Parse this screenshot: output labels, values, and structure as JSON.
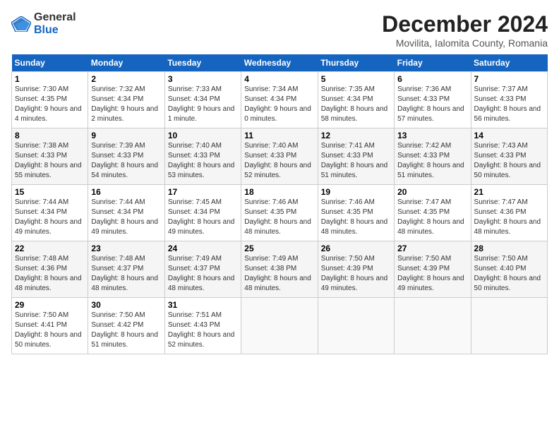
{
  "header": {
    "logo_general": "General",
    "logo_blue": "Blue",
    "month_title": "December 2024",
    "location": "Movilita, Ialomita County, Romania"
  },
  "weekdays": [
    "Sunday",
    "Monday",
    "Tuesday",
    "Wednesday",
    "Thursday",
    "Friday",
    "Saturday"
  ],
  "weeks": [
    [
      {
        "day": "1",
        "sunrise": "Sunrise: 7:30 AM",
        "sunset": "Sunset: 4:35 PM",
        "daylight": "Daylight: 9 hours and 4 minutes."
      },
      {
        "day": "2",
        "sunrise": "Sunrise: 7:32 AM",
        "sunset": "Sunset: 4:34 PM",
        "daylight": "Daylight: 9 hours and 2 minutes."
      },
      {
        "day": "3",
        "sunrise": "Sunrise: 7:33 AM",
        "sunset": "Sunset: 4:34 PM",
        "daylight": "Daylight: 9 hours and 1 minute."
      },
      {
        "day": "4",
        "sunrise": "Sunrise: 7:34 AM",
        "sunset": "Sunset: 4:34 PM",
        "daylight": "Daylight: 9 hours and 0 minutes."
      },
      {
        "day": "5",
        "sunrise": "Sunrise: 7:35 AM",
        "sunset": "Sunset: 4:34 PM",
        "daylight": "Daylight: 8 hours and 58 minutes."
      },
      {
        "day": "6",
        "sunrise": "Sunrise: 7:36 AM",
        "sunset": "Sunset: 4:33 PM",
        "daylight": "Daylight: 8 hours and 57 minutes."
      },
      {
        "day": "7",
        "sunrise": "Sunrise: 7:37 AM",
        "sunset": "Sunset: 4:33 PM",
        "daylight": "Daylight: 8 hours and 56 minutes."
      }
    ],
    [
      {
        "day": "8",
        "sunrise": "Sunrise: 7:38 AM",
        "sunset": "Sunset: 4:33 PM",
        "daylight": "Daylight: 8 hours and 55 minutes."
      },
      {
        "day": "9",
        "sunrise": "Sunrise: 7:39 AM",
        "sunset": "Sunset: 4:33 PM",
        "daylight": "Daylight: 8 hours and 54 minutes."
      },
      {
        "day": "10",
        "sunrise": "Sunrise: 7:40 AM",
        "sunset": "Sunset: 4:33 PM",
        "daylight": "Daylight: 8 hours and 53 minutes."
      },
      {
        "day": "11",
        "sunrise": "Sunrise: 7:40 AM",
        "sunset": "Sunset: 4:33 PM",
        "daylight": "Daylight: 8 hours and 52 minutes."
      },
      {
        "day": "12",
        "sunrise": "Sunrise: 7:41 AM",
        "sunset": "Sunset: 4:33 PM",
        "daylight": "Daylight: 8 hours and 51 minutes."
      },
      {
        "day": "13",
        "sunrise": "Sunrise: 7:42 AM",
        "sunset": "Sunset: 4:33 PM",
        "daylight": "Daylight: 8 hours and 51 minutes."
      },
      {
        "day": "14",
        "sunrise": "Sunrise: 7:43 AM",
        "sunset": "Sunset: 4:33 PM",
        "daylight": "Daylight: 8 hours and 50 minutes."
      }
    ],
    [
      {
        "day": "15",
        "sunrise": "Sunrise: 7:44 AM",
        "sunset": "Sunset: 4:34 PM",
        "daylight": "Daylight: 8 hours and 49 minutes."
      },
      {
        "day": "16",
        "sunrise": "Sunrise: 7:44 AM",
        "sunset": "Sunset: 4:34 PM",
        "daylight": "Daylight: 8 hours and 49 minutes."
      },
      {
        "day": "17",
        "sunrise": "Sunrise: 7:45 AM",
        "sunset": "Sunset: 4:34 PM",
        "daylight": "Daylight: 8 hours and 49 minutes."
      },
      {
        "day": "18",
        "sunrise": "Sunrise: 7:46 AM",
        "sunset": "Sunset: 4:35 PM",
        "daylight": "Daylight: 8 hours and 48 minutes."
      },
      {
        "day": "19",
        "sunrise": "Sunrise: 7:46 AM",
        "sunset": "Sunset: 4:35 PM",
        "daylight": "Daylight: 8 hours and 48 minutes."
      },
      {
        "day": "20",
        "sunrise": "Sunrise: 7:47 AM",
        "sunset": "Sunset: 4:35 PM",
        "daylight": "Daylight: 8 hours and 48 minutes."
      },
      {
        "day": "21",
        "sunrise": "Sunrise: 7:47 AM",
        "sunset": "Sunset: 4:36 PM",
        "daylight": "Daylight: 8 hours and 48 minutes."
      }
    ],
    [
      {
        "day": "22",
        "sunrise": "Sunrise: 7:48 AM",
        "sunset": "Sunset: 4:36 PM",
        "daylight": "Daylight: 8 hours and 48 minutes."
      },
      {
        "day": "23",
        "sunrise": "Sunrise: 7:48 AM",
        "sunset": "Sunset: 4:37 PM",
        "daylight": "Daylight: 8 hours and 48 minutes."
      },
      {
        "day": "24",
        "sunrise": "Sunrise: 7:49 AM",
        "sunset": "Sunset: 4:37 PM",
        "daylight": "Daylight: 8 hours and 48 minutes."
      },
      {
        "day": "25",
        "sunrise": "Sunrise: 7:49 AM",
        "sunset": "Sunset: 4:38 PM",
        "daylight": "Daylight: 8 hours and 48 minutes."
      },
      {
        "day": "26",
        "sunrise": "Sunrise: 7:50 AM",
        "sunset": "Sunset: 4:39 PM",
        "daylight": "Daylight: 8 hours and 49 minutes."
      },
      {
        "day": "27",
        "sunrise": "Sunrise: 7:50 AM",
        "sunset": "Sunset: 4:39 PM",
        "daylight": "Daylight: 8 hours and 49 minutes."
      },
      {
        "day": "28",
        "sunrise": "Sunrise: 7:50 AM",
        "sunset": "Sunset: 4:40 PM",
        "daylight": "Daylight: 8 hours and 50 minutes."
      }
    ],
    [
      {
        "day": "29",
        "sunrise": "Sunrise: 7:50 AM",
        "sunset": "Sunset: 4:41 PM",
        "daylight": "Daylight: 8 hours and 50 minutes."
      },
      {
        "day": "30",
        "sunrise": "Sunrise: 7:50 AM",
        "sunset": "Sunset: 4:42 PM",
        "daylight": "Daylight: 8 hours and 51 minutes."
      },
      {
        "day": "31",
        "sunrise": "Sunrise: 7:51 AM",
        "sunset": "Sunset: 4:43 PM",
        "daylight": "Daylight: 8 hours and 52 minutes."
      },
      null,
      null,
      null,
      null
    ]
  ]
}
